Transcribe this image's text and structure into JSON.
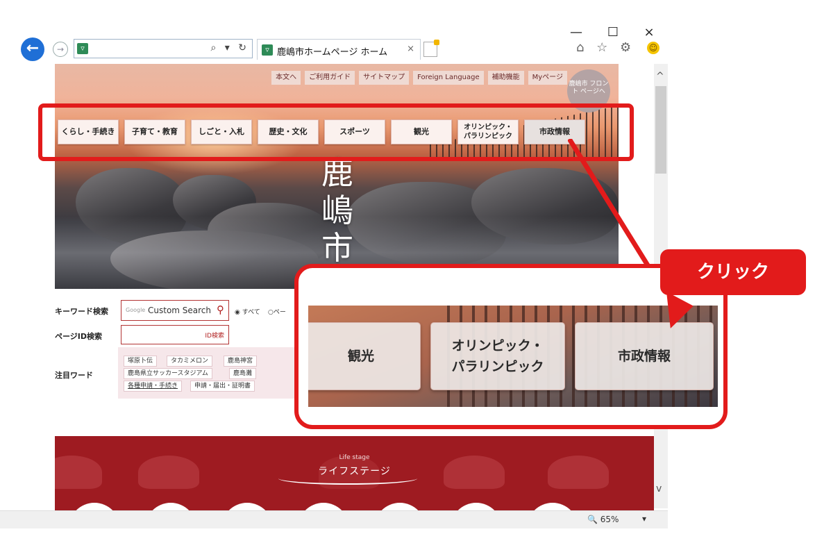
{
  "browser": {
    "tab_title": "鹿嶋市ホームページ ホーム",
    "tab_close": "×",
    "window_controls": [
      "—",
      "☐",
      "×"
    ],
    "address_tools": "⌕ ▾ ↻",
    "right_icons": "⌂ ☆ ⚙",
    "zoom_level": "65%",
    "zoom_icon": "🔍"
  },
  "header": {
    "top_links": [
      "本文へ",
      "ご利用ガイド",
      "サイトマップ",
      "Foreign Language",
      "補助機能",
      "Myページ"
    ],
    "front_page_button": "鹿嶋市 フロント ページへ",
    "site_title_kanji": "鹿嶋市",
    "categories": [
      "くらし・手続き",
      "子育て・教育",
      "しごと・入札",
      "歴史・文化",
      "スポーツ",
      "観光",
      "オリンピック・\nパラリンピック",
      "市政情報"
    ]
  },
  "search": {
    "keyword_label": "キーワード検索",
    "google_tag": "Google",
    "keyword_placeholder": "Custom Search",
    "search_icon": "search-icon",
    "radio_all": "◉ すべて",
    "radio_page": "○ペー",
    "pageid_label": "ページID検索",
    "pageid_button": "ID検索"
  },
  "attention": {
    "label": "注目ワード",
    "words": [
      "塚原卜伝",
      "タカミメロン",
      "鹿島神宮",
      "鹿島県立サッカースタジアム",
      "鹿島灘",
      "各種申請・手続き",
      "申請・届出・証明書"
    ]
  },
  "life_stage": {
    "en": "Life stage",
    "jp": "ライフステージ"
  },
  "annotation": {
    "zoom_buttons": [
      "観光",
      "オリンピック・\nパラリンピック",
      "市政情報"
    ],
    "callout": "クリック",
    "accent_color": "#e21b1b"
  }
}
